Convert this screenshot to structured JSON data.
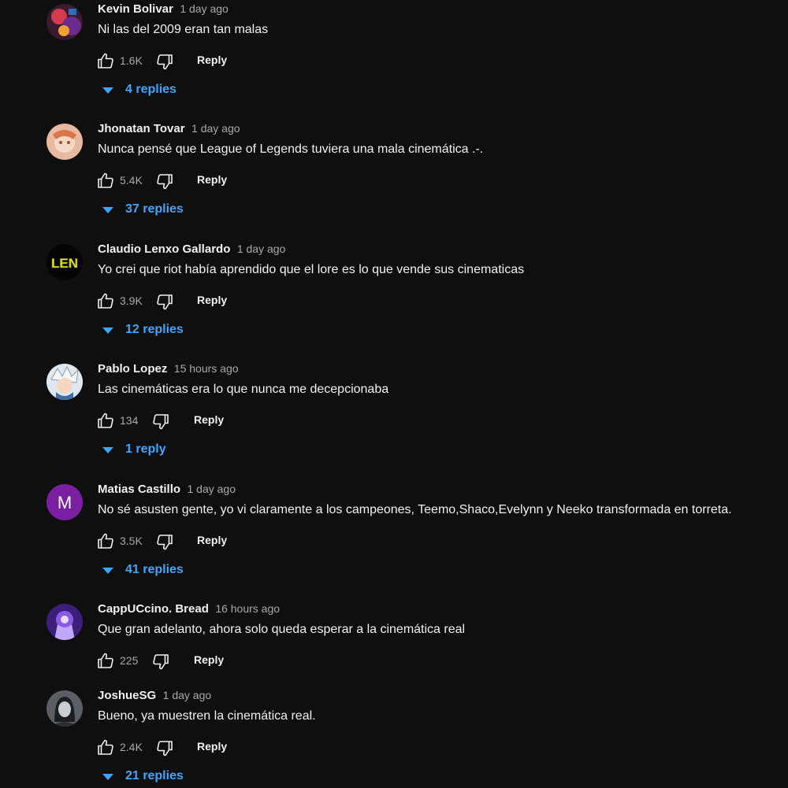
{
  "comments": [
    {
      "author": "Kevin Bolivar",
      "time": "1 day ago",
      "text": "Ni las del 2009 eran tan malas",
      "likes": "1.6K",
      "reply_label": "Reply",
      "replies_label": "4 replies",
      "avatar": "avatar-dark-art"
    },
    {
      "author": "Jhonatan Tovar",
      "time": "1 day ago",
      "text": "Nunca pensé que League of Legends tuviera una mala cinemática .-.",
      "likes": "5.4K",
      "reply_label": "Reply",
      "replies_label": "37 replies",
      "avatar": "avatar-peach-art"
    },
    {
      "author": "Claudio Lenxo Gallardo",
      "time": "1 day ago",
      "text": "Yo crei que riot había aprendido que el lore es lo que vende sus cinematicas",
      "likes": "3.9K",
      "reply_label": "Reply",
      "replies_label": "12 replies",
      "avatar": "avatar-len-logo",
      "avatar_text": "LEN"
    },
    {
      "author": "Pablo Lopez",
      "time": "15 hours ago",
      "text": "Las cinemáticas era lo que nunca me decepcionaba",
      "likes": "134",
      "reply_label": "Reply",
      "replies_label": "1 reply",
      "avatar": "avatar-anime-art"
    },
    {
      "author": "Matias Castillo",
      "time": "1 day ago",
      "text": "No sé asusten gente, yo vi claramente a los campeones, Teemo,Shaco,Evelynn y Neeko transformada en torreta.",
      "likes": "3.5K",
      "reply_label": "Reply",
      "replies_label": "41 replies",
      "avatar": "avatar-letter",
      "avatar_text": "M"
    },
    {
      "author": "CappUCcino. Bread",
      "time": "16 hours ago",
      "text": "Que gran adelanto, ahora solo queda esperar a la cinemática real",
      "likes": "225",
      "reply_label": "Reply",
      "replies_label": null,
      "avatar": "avatar-purple-art"
    },
    {
      "author": "JoshueSG",
      "time": "1 day ago",
      "text": "Bueno, ya muestren la cinemática real.",
      "likes": "2.4K",
      "reply_label": "Reply",
      "replies_label": "21 replies",
      "avatar": "avatar-grey-art"
    }
  ],
  "colors": {
    "background": "#0f0f0f",
    "link_blue": "#3ea6ff",
    "muted": "#aaaaaa",
    "text": "#f1f1f1",
    "letter_avatar": "#7b1fa2"
  },
  "icons": {
    "like": "thumb-up-outline-icon",
    "dislike": "thumb-down-outline-icon",
    "expand": "caret-down-icon"
  }
}
